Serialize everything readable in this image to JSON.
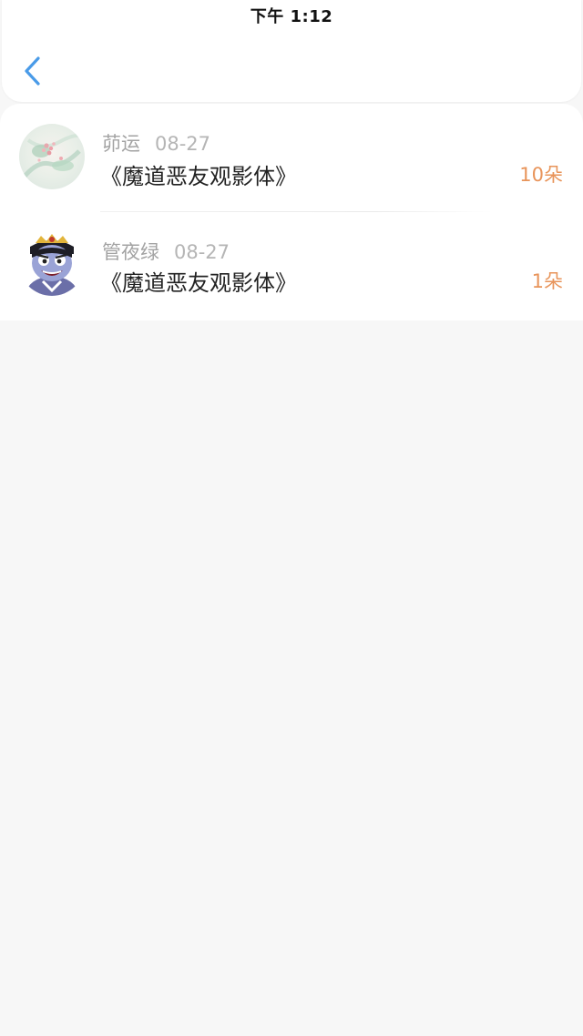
{
  "status_bar": {
    "time": "下午 1:12"
  },
  "nav": {
    "back_icon": "chevron-left-icon",
    "accent_color": "#4a9be8"
  },
  "items": [
    {
      "name": "茆运",
      "date": "08-27",
      "title": "《魔道恶友观影体》",
      "count": "10朵",
      "avatar": "floral-watercolor-avatar"
    },
    {
      "name": "管夜绿",
      "date": "08-27",
      "title": "《魔道恶友观影体》",
      "count": "1朵",
      "avatar": "cartoon-character-avatar"
    }
  ],
  "colors": {
    "count_text": "#e8945a",
    "meta_text": "#a3a3a3",
    "background": "#f7f7f7"
  }
}
